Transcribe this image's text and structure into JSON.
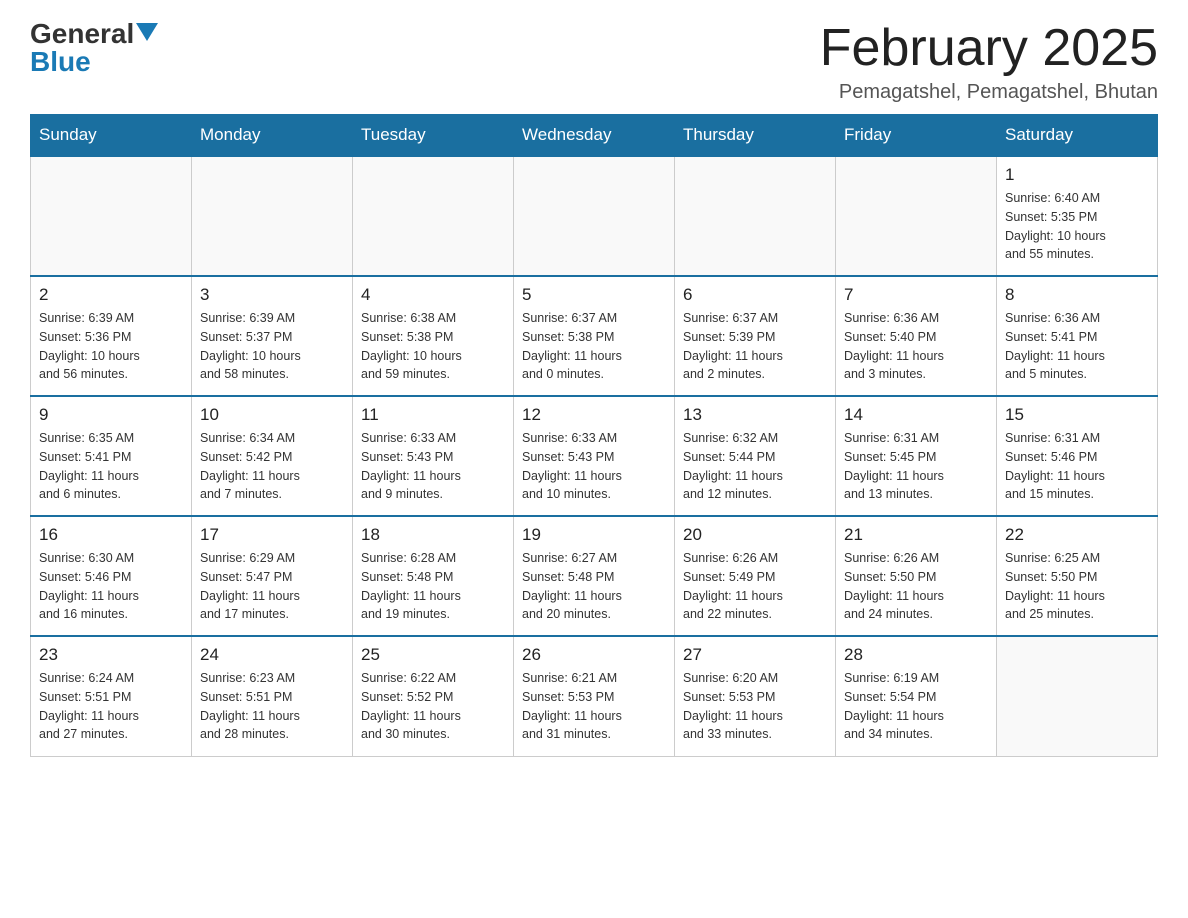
{
  "logo": {
    "general": "General",
    "blue": "Blue"
  },
  "title": "February 2025",
  "subtitle": "Pemagatshel, Pemagatshel, Bhutan",
  "weekdays": [
    "Sunday",
    "Monday",
    "Tuesday",
    "Wednesday",
    "Thursday",
    "Friday",
    "Saturday"
  ],
  "weeks": [
    [
      {
        "day": "",
        "info": ""
      },
      {
        "day": "",
        "info": ""
      },
      {
        "day": "",
        "info": ""
      },
      {
        "day": "",
        "info": ""
      },
      {
        "day": "",
        "info": ""
      },
      {
        "day": "",
        "info": ""
      },
      {
        "day": "1",
        "info": "Sunrise: 6:40 AM\nSunset: 5:35 PM\nDaylight: 10 hours\nand 55 minutes."
      }
    ],
    [
      {
        "day": "2",
        "info": "Sunrise: 6:39 AM\nSunset: 5:36 PM\nDaylight: 10 hours\nand 56 minutes."
      },
      {
        "day": "3",
        "info": "Sunrise: 6:39 AM\nSunset: 5:37 PM\nDaylight: 10 hours\nand 58 minutes."
      },
      {
        "day": "4",
        "info": "Sunrise: 6:38 AM\nSunset: 5:38 PM\nDaylight: 10 hours\nand 59 minutes."
      },
      {
        "day": "5",
        "info": "Sunrise: 6:37 AM\nSunset: 5:38 PM\nDaylight: 11 hours\nand 0 minutes."
      },
      {
        "day": "6",
        "info": "Sunrise: 6:37 AM\nSunset: 5:39 PM\nDaylight: 11 hours\nand 2 minutes."
      },
      {
        "day": "7",
        "info": "Sunrise: 6:36 AM\nSunset: 5:40 PM\nDaylight: 11 hours\nand 3 minutes."
      },
      {
        "day": "8",
        "info": "Sunrise: 6:36 AM\nSunset: 5:41 PM\nDaylight: 11 hours\nand 5 minutes."
      }
    ],
    [
      {
        "day": "9",
        "info": "Sunrise: 6:35 AM\nSunset: 5:41 PM\nDaylight: 11 hours\nand 6 minutes."
      },
      {
        "day": "10",
        "info": "Sunrise: 6:34 AM\nSunset: 5:42 PM\nDaylight: 11 hours\nand 7 minutes."
      },
      {
        "day": "11",
        "info": "Sunrise: 6:33 AM\nSunset: 5:43 PM\nDaylight: 11 hours\nand 9 minutes."
      },
      {
        "day": "12",
        "info": "Sunrise: 6:33 AM\nSunset: 5:43 PM\nDaylight: 11 hours\nand 10 minutes."
      },
      {
        "day": "13",
        "info": "Sunrise: 6:32 AM\nSunset: 5:44 PM\nDaylight: 11 hours\nand 12 minutes."
      },
      {
        "day": "14",
        "info": "Sunrise: 6:31 AM\nSunset: 5:45 PM\nDaylight: 11 hours\nand 13 minutes."
      },
      {
        "day": "15",
        "info": "Sunrise: 6:31 AM\nSunset: 5:46 PM\nDaylight: 11 hours\nand 15 minutes."
      }
    ],
    [
      {
        "day": "16",
        "info": "Sunrise: 6:30 AM\nSunset: 5:46 PM\nDaylight: 11 hours\nand 16 minutes."
      },
      {
        "day": "17",
        "info": "Sunrise: 6:29 AM\nSunset: 5:47 PM\nDaylight: 11 hours\nand 17 minutes."
      },
      {
        "day": "18",
        "info": "Sunrise: 6:28 AM\nSunset: 5:48 PM\nDaylight: 11 hours\nand 19 minutes."
      },
      {
        "day": "19",
        "info": "Sunrise: 6:27 AM\nSunset: 5:48 PM\nDaylight: 11 hours\nand 20 minutes."
      },
      {
        "day": "20",
        "info": "Sunrise: 6:26 AM\nSunset: 5:49 PM\nDaylight: 11 hours\nand 22 minutes."
      },
      {
        "day": "21",
        "info": "Sunrise: 6:26 AM\nSunset: 5:50 PM\nDaylight: 11 hours\nand 24 minutes."
      },
      {
        "day": "22",
        "info": "Sunrise: 6:25 AM\nSunset: 5:50 PM\nDaylight: 11 hours\nand 25 minutes."
      }
    ],
    [
      {
        "day": "23",
        "info": "Sunrise: 6:24 AM\nSunset: 5:51 PM\nDaylight: 11 hours\nand 27 minutes."
      },
      {
        "day": "24",
        "info": "Sunrise: 6:23 AM\nSunset: 5:51 PM\nDaylight: 11 hours\nand 28 minutes."
      },
      {
        "day": "25",
        "info": "Sunrise: 6:22 AM\nSunset: 5:52 PM\nDaylight: 11 hours\nand 30 minutes."
      },
      {
        "day": "26",
        "info": "Sunrise: 6:21 AM\nSunset: 5:53 PM\nDaylight: 11 hours\nand 31 minutes."
      },
      {
        "day": "27",
        "info": "Sunrise: 6:20 AM\nSunset: 5:53 PM\nDaylight: 11 hours\nand 33 minutes."
      },
      {
        "day": "28",
        "info": "Sunrise: 6:19 AM\nSunset: 5:54 PM\nDaylight: 11 hours\nand 34 minutes."
      },
      {
        "day": "",
        "info": ""
      }
    ]
  ]
}
